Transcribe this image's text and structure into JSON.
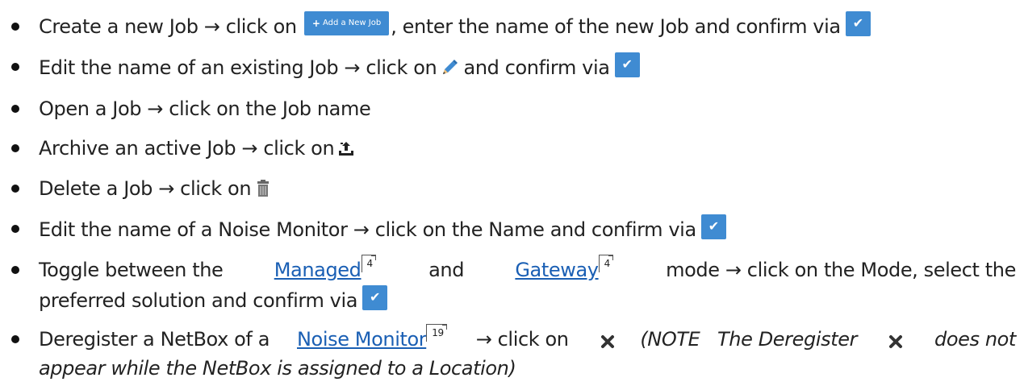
{
  "items": [
    {
      "text_a": "Create a new Job → click on ",
      "button_label": "Add a New Job",
      "text_b": ", enter the name of the new Job and confirm via"
    },
    {
      "text_a": "Edit the name of an existing Job → click on",
      "text_b": " and confirm via"
    },
    {
      "text_a": "Open a Job → click on the Job name"
    },
    {
      "text_a": "Archive an active Job → click on"
    },
    {
      "text_a": "Delete a Job → click on"
    },
    {
      "text_a": "Edit the name of a Noise Monitor → click on the Name and confirm via"
    },
    {
      "text_a": "Toggle between the ",
      "link_managed": "Managed",
      "ref_managed": "4",
      "text_b": " and ",
      "link_gateway": "Gateway",
      "ref_gateway": "4",
      "text_c": " mode → click on the Mode, select the",
      "line2": "preferred solution and confirm via"
    },
    {
      "text_a": "Deregister a NetBox of a ",
      "link_noise": "Noise Monitor",
      "ref_noise": "19",
      "text_b": " → click on ",
      "note_a": "(NOTE   The Deregister ",
      "note_b": " does not",
      "line2": "appear while the NetBox is assigned to a Location)"
    }
  ],
  "icons": {
    "check": "check-icon",
    "pencil": "pencil-icon",
    "archive": "archive-icon",
    "trash": "trash-icon",
    "x": "x-icon",
    "plus": "plus-icon"
  },
  "colors": {
    "button_blue": "#3f8bd2",
    "link_blue": "#1a5fb4",
    "text": "#222222"
  }
}
